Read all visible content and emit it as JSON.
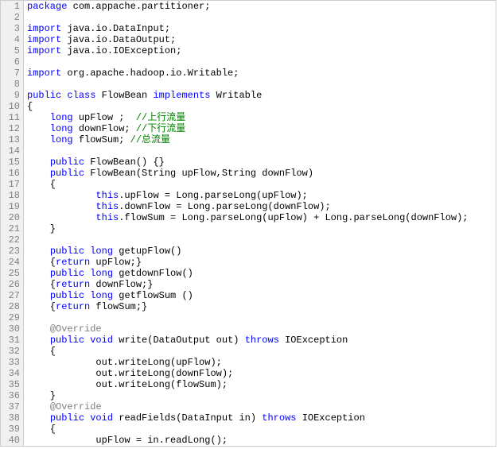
{
  "lines": [
    {
      "n": 1,
      "html": "<span class='kw'>package</span> com.appache.partitioner;"
    },
    {
      "n": 2,
      "html": ""
    },
    {
      "n": 3,
      "html": "<span class='kw'>import</span> java.io.DataInput;"
    },
    {
      "n": 4,
      "html": "<span class='kw'>import</span> java.io.DataOutput;"
    },
    {
      "n": 5,
      "html": "<span class='kw'>import</span> java.io.IOException;"
    },
    {
      "n": 6,
      "html": ""
    },
    {
      "n": 7,
      "html": "<span class='kw'>import</span> org.apache.hadoop.io.Writable;"
    },
    {
      "n": 8,
      "html": ""
    },
    {
      "n": 9,
      "html": "<span class='kw'>public</span> <span class='kw'>class</span> FlowBean <span class='kw'>implements</span> Writable"
    },
    {
      "n": 10,
      "html": "{"
    },
    {
      "n": 11,
      "html": "    <span class='kw'>long</span> upFlow ;  <span class='cmt'>//上行流量</span>"
    },
    {
      "n": 12,
      "html": "    <span class='kw'>long</span> downFlow; <span class='cmt'>//下行流量</span>"
    },
    {
      "n": 13,
      "html": "    <span class='kw'>long</span> flowSum; <span class='cmt'>//总流量</span>"
    },
    {
      "n": 14,
      "html": ""
    },
    {
      "n": 15,
      "html": "    <span class='kw'>public</span> FlowBean() {}"
    },
    {
      "n": 16,
      "html": "    <span class='kw'>public</span> FlowBean(String upFlow,String downFlow)"
    },
    {
      "n": 17,
      "html": "    {"
    },
    {
      "n": 18,
      "html": "            <span class='kw'>this</span>.upFlow = Long.parseLong(upFlow);"
    },
    {
      "n": 19,
      "html": "            <span class='kw'>this</span>.downFlow = Long.parseLong(downFlow);"
    },
    {
      "n": 20,
      "html": "            <span class='kw'>this</span>.flowSum = Long.parseLong(upFlow) + Long.parseLong(downFlow);"
    },
    {
      "n": 21,
      "html": "    }"
    },
    {
      "n": 22,
      "html": ""
    },
    {
      "n": 23,
      "html": "    <span class='kw'>public</span> <span class='kw'>long</span> getupFlow()"
    },
    {
      "n": 24,
      "html": "    {<span class='kw'>return</span> upFlow;}"
    },
    {
      "n": 25,
      "html": "    <span class='kw'>public</span> <span class='kw'>long</span> getdownFlow()"
    },
    {
      "n": 26,
      "html": "    {<span class='kw'>return</span> downFlow;}"
    },
    {
      "n": 27,
      "html": "    <span class='kw'>public</span> <span class='kw'>long</span> getflowSum ()"
    },
    {
      "n": 28,
      "html": "    {<span class='kw'>return</span> flowSum;}"
    },
    {
      "n": 29,
      "html": ""
    },
    {
      "n": 30,
      "html": "    <span class='ann'>@Override</span>"
    },
    {
      "n": 31,
      "html": "    <span class='kw'>public</span> <span class='kw'>void</span> write(DataOutput out) <span class='kw'>throws</span> IOException"
    },
    {
      "n": 32,
      "html": "    {"
    },
    {
      "n": 33,
      "html": "            out.writeLong(upFlow);"
    },
    {
      "n": 34,
      "html": "            out.writeLong(downFlow);"
    },
    {
      "n": 35,
      "html": "            out.writeLong(flowSum);"
    },
    {
      "n": 36,
      "html": "    }"
    },
    {
      "n": 37,
      "html": "    <span class='ann'>@Override</span>"
    },
    {
      "n": 38,
      "html": "    <span class='kw'>public</span> <span class='kw'>void</span> readFields(DataInput in) <span class='kw'>throws</span> IOException"
    },
    {
      "n": 39,
      "html": "    {"
    },
    {
      "n": 40,
      "html": "            upFlow = in.readLong();"
    }
  ]
}
